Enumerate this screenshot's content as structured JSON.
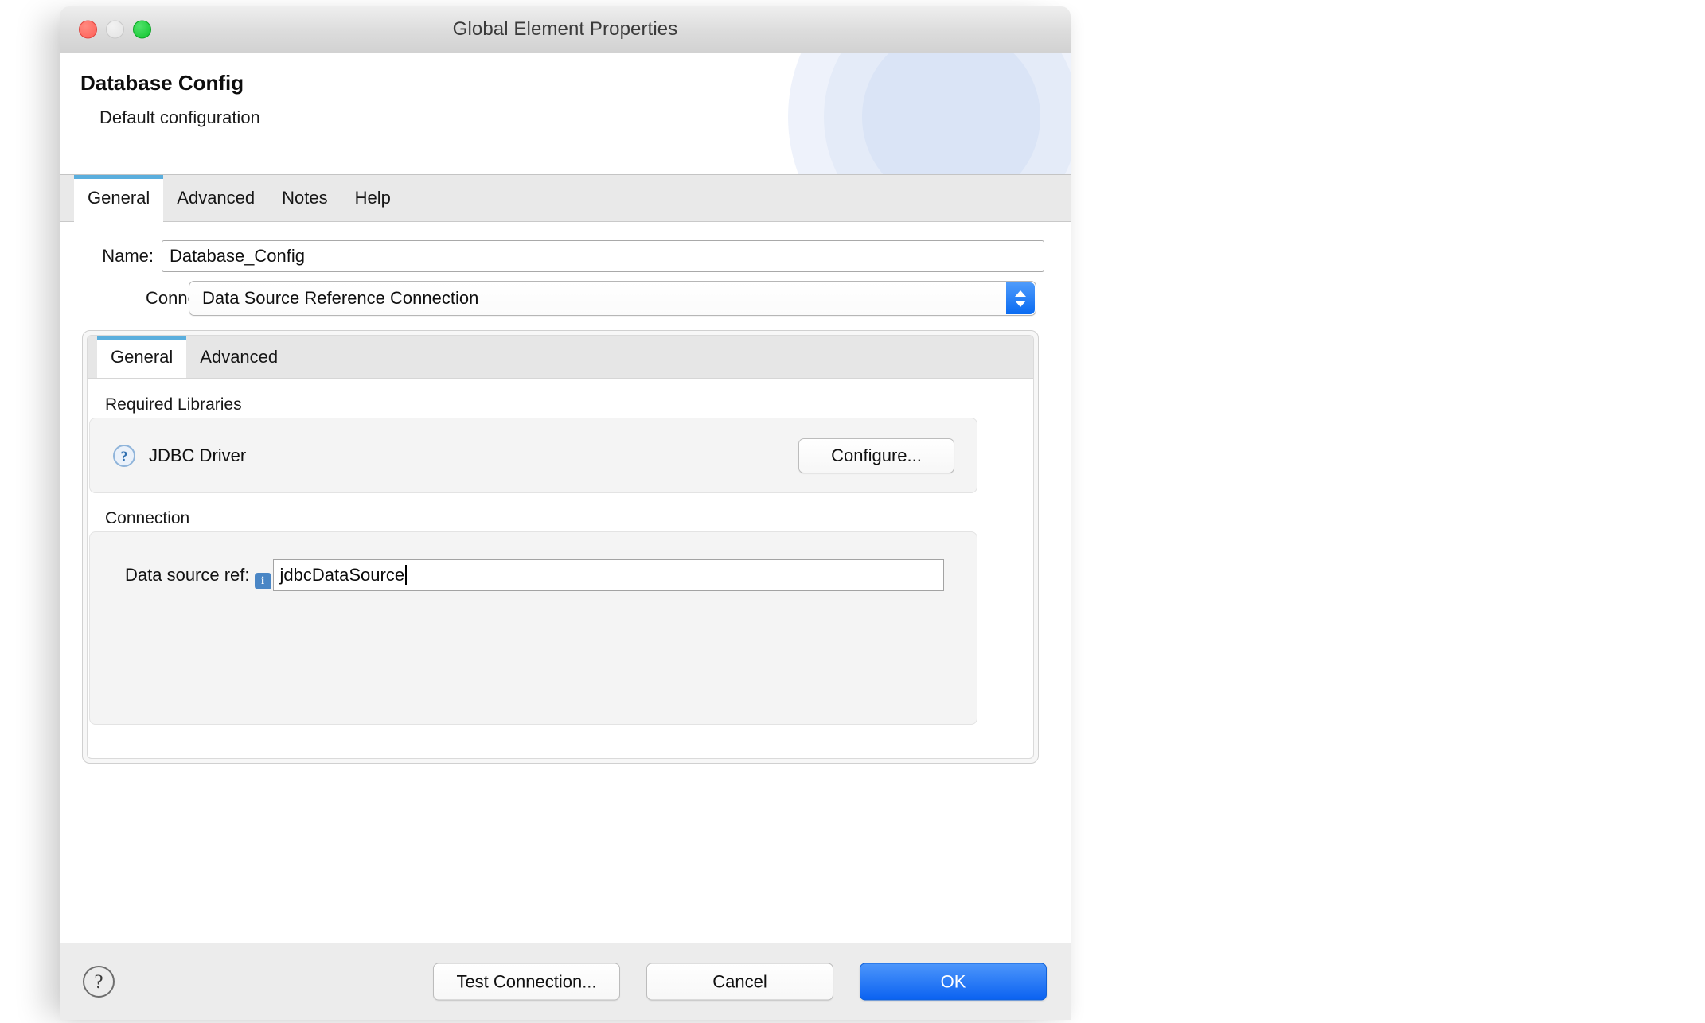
{
  "window": {
    "title": "Global Element Properties",
    "controls": {
      "close": "close-button",
      "minimize": "minimize-button",
      "zoom": "zoom-button"
    }
  },
  "header": {
    "title": "Database Config",
    "subtitle": "Default configuration"
  },
  "tabs": [
    {
      "label": "General",
      "active": true
    },
    {
      "label": "Advanced",
      "active": false
    },
    {
      "label": "Notes",
      "active": false
    },
    {
      "label": "Help",
      "active": false
    }
  ],
  "form": {
    "name": {
      "label": "Name:",
      "value": "Database_Config",
      "placeholder": ""
    },
    "connection": {
      "label": "Connection",
      "value": "Data Source Reference Connection"
    }
  },
  "inner_tabs": [
    {
      "label": "General",
      "active": true
    },
    {
      "label": "Advanced",
      "active": false
    }
  ],
  "required_libraries": {
    "title": "Required Libraries",
    "item_label": "JDBC Driver",
    "configure_label": "Configure...",
    "icon": "question-circle-icon"
  },
  "connection_section": {
    "title": "Connection",
    "data_source_ref": {
      "label": "Data source ref:",
      "value": "jdbcDataSource",
      "placeholder": "",
      "info_badge": "i"
    }
  },
  "footer": {
    "help": "?",
    "test_connection_label": "Test Connection...",
    "cancel_label": "Cancel",
    "ok_label": "OK"
  },
  "colors": {
    "accent_tab": "#5aaedd",
    "primary_button": "#0b62f1",
    "info_badge": "#4a86c5",
    "help_icon": "#3f7fbf"
  }
}
